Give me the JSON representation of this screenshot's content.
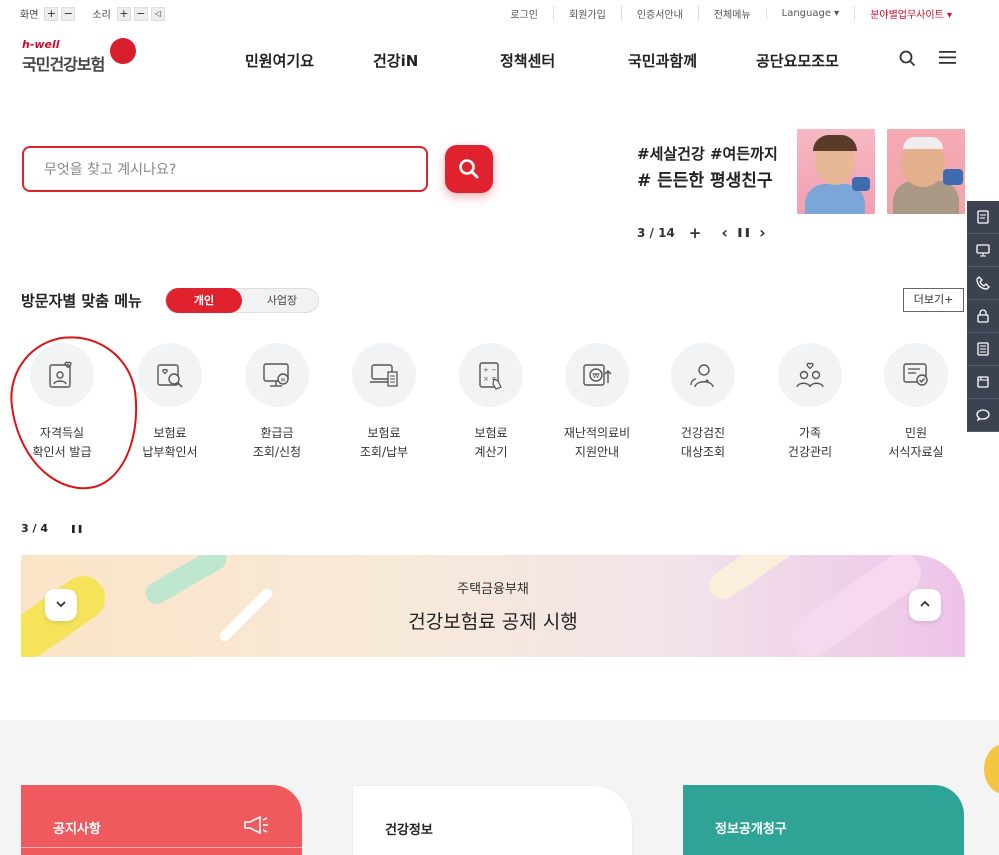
{
  "util": {
    "screen_label": "화면",
    "sound_label": "소리",
    "plus": "+",
    "minus": "−",
    "links": [
      "로그인",
      "회원가입",
      "인증서안내",
      "전체메뉴",
      "Language ▾",
      "분야별업무사이트 ▾"
    ]
  },
  "logo": {
    "hwell": "h-well",
    "name": "국민건강보험"
  },
  "gnb": [
    "민원여기요",
    "건강iN",
    "정책센터",
    "국민과함께",
    "공단요모조모"
  ],
  "search": {
    "placeholder": "무엇을 찾고 계시나요?"
  },
  "banner": {
    "line1": "#세살건강 #여든까지",
    "line2": "# 든든한 평생친구",
    "counter": "3 / 14",
    "plus": "+",
    "prev": "‹",
    "pause": "❚❚",
    "next": "›"
  },
  "quick": {
    "title": "방문자별 맞춤 메뉴",
    "tab_personal": "개인",
    "tab_business": "사업장",
    "more": "더보기+",
    "items": [
      {
        "label": "자격득실\n확인서 발급"
      },
      {
        "label": "보험료\n납부확인서"
      },
      {
        "label": "환급금\n조회/신청"
      },
      {
        "label": "보험료\n조회/납부"
      },
      {
        "label": "보험료\n계산기"
      },
      {
        "label": "재난적의료비\n지원안내"
      },
      {
        "label": "건강검진\n대상조회"
      },
      {
        "label": "가족\n건강관리"
      },
      {
        "label": "민원\n서식자료실"
      }
    ],
    "pager": "3 / 4",
    "pager_pause": "❚❚"
  },
  "notice": {
    "sub": "주택금융부채",
    "title": "건강보험료 공제 시행",
    "down": "⌄",
    "up": "⌃"
  },
  "cards": {
    "c1": "공지사항",
    "c2": "건강정보",
    "c3": "정보공개청구"
  },
  "colors": {
    "brand_red": "#e0222e",
    "teal": "#2ea396",
    "coral": "#ef5a5f"
  }
}
